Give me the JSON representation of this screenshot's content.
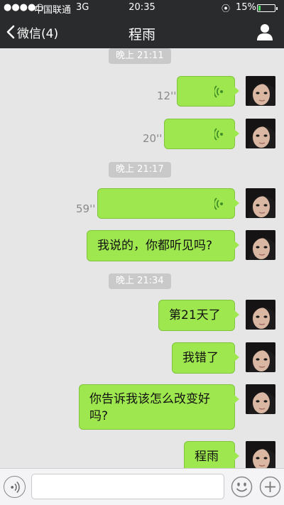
{
  "status_bar": {
    "signal": "●●●●○",
    "carrier": "中国联通",
    "network": "3G",
    "time": "20:35",
    "lock_icon": "⦿",
    "battery_percent": "15%",
    "battery_level": 0.15
  },
  "nav": {
    "back_label": "微信(4)",
    "title": "程雨"
  },
  "chat": {
    "time_labels": [
      "晚上 21:11",
      "晚上 21:17",
      "晚上 21:34"
    ],
    "voice_messages": [
      {
        "duration": "12''"
      },
      {
        "duration": "20''"
      },
      {
        "duration": "59''"
      }
    ],
    "text_messages": [
      "我说的，你都听见吗?",
      "第21天了",
      "我错了",
      "你告诉我该怎么改变好吗?",
      "程雨"
    ]
  },
  "input_bar": {
    "placeholder": ""
  },
  "colors": {
    "bubble": "#9ee74f",
    "bar": "#2a2b2c",
    "background": "#e6e6e6"
  }
}
